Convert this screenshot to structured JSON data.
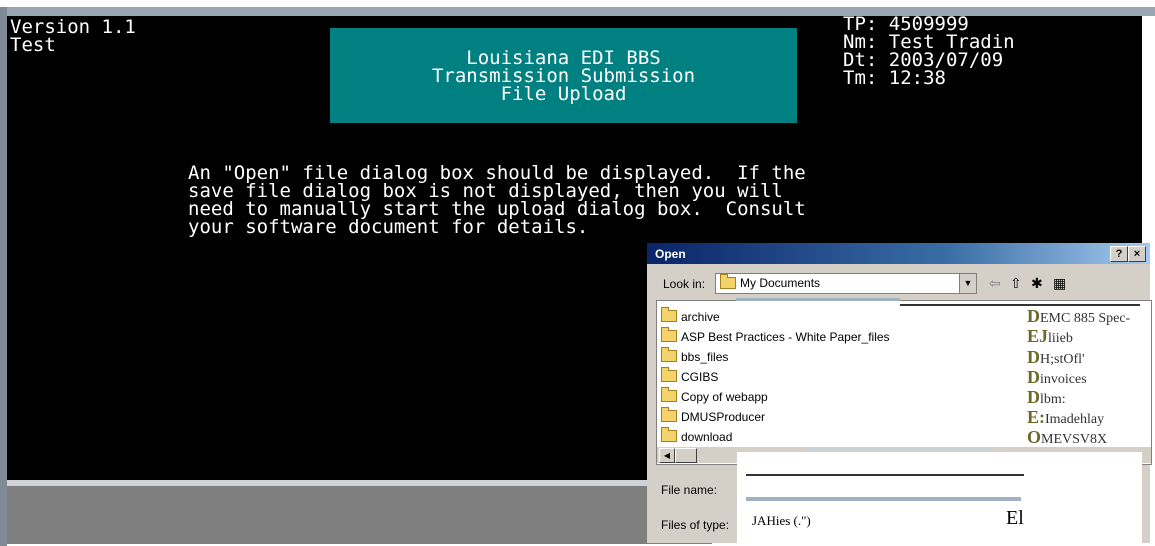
{
  "terminal": {
    "version_line1": "Version 1.1",
    "version_line2": "Test",
    "banner": [
      "Louisiana EDI BBS",
      "Transmission Submission",
      "File Upload"
    ],
    "info": [
      "TP: 4509999",
      "Nm: Test Tradin",
      "Dt: 2003/07/09",
      "Tm: 12:38"
    ],
    "instructions": [
      "An \"Open\" file dialog box should be displayed.  If the",
      "save file dialog box is not displayed, then you will",
      "need to manually start the upload dialog box.  Consult",
      "your software document for details."
    ]
  },
  "dialog": {
    "title": "Open",
    "help_label": "?",
    "close_label": "×",
    "look_in_label": "Look in:",
    "look_in_value": "My Documents",
    "folders": [
      "archive",
      "ASP Best Practices - White Paper_files",
      "bbs_files",
      "CGIBS",
      "Copy of webapp",
      "DMUSProducer",
      "download"
    ],
    "right_items": [
      {
        "initial": "D",
        "rest": "EMC 885 Spec-"
      },
      {
        "initial": "EJ",
        "rest": "liieb"
      },
      {
        "initial": "D",
        "rest": "H;stOfl'"
      },
      {
        "initial": "D",
        "rest": "invoices"
      },
      {
        "initial": "D",
        "rest": "lbm:"
      },
      {
        "initial": "E:",
        "rest": "Imadehlay"
      },
      {
        "initial": "O",
        "rest": "MEVSV8X"
      }
    ],
    "file_name_label": "File name:",
    "files_of_type_label": "Files of type:",
    "files_of_type_value": "JAHies (.\")",
    "files_of_type_suffix": "El"
  },
  "colors": {
    "terminal_bg": "#000000",
    "banner_bg": "#008080",
    "dialog_bg": "#d4d0c8",
    "title_start": "#0a246a"
  }
}
